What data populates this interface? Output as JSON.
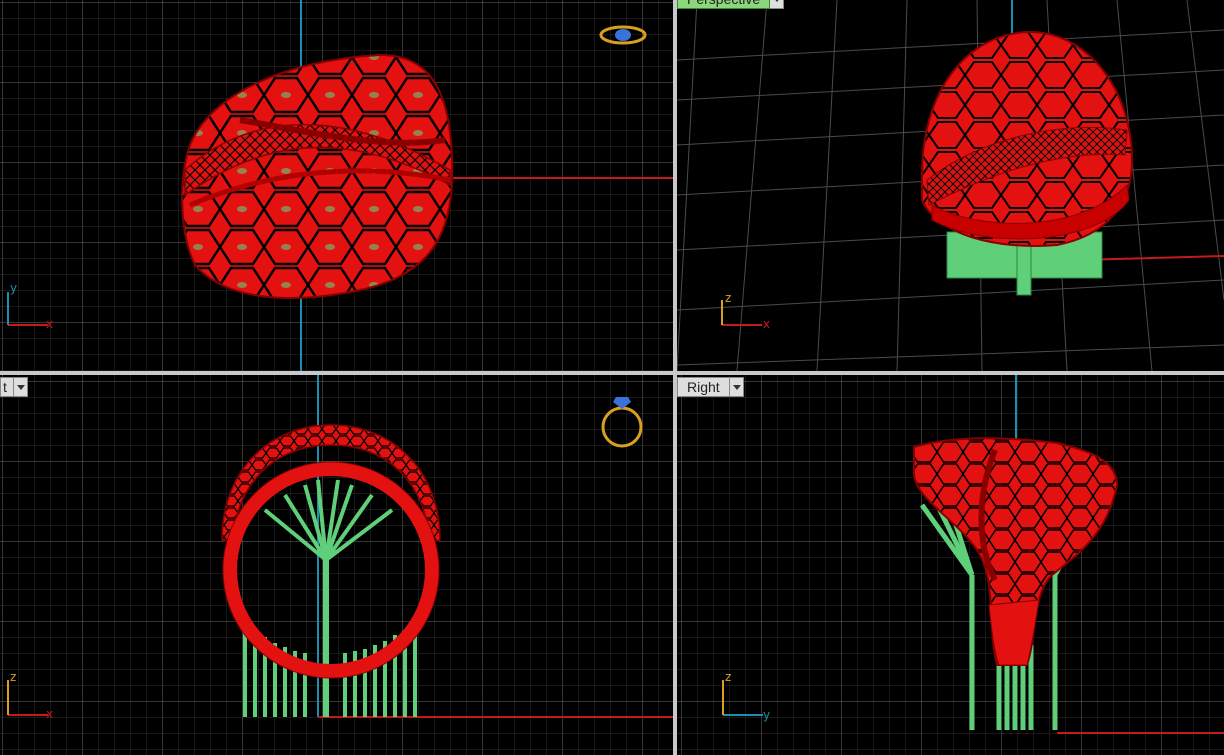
{
  "app": {
    "colors": {
      "frame": "#c8c8c8",
      "background": "#000000",
      "grid_minor": "#2e2e2e",
      "grid_major": "#6a6a6a",
      "axis_x": "#c41a1a",
      "axis_y": "#1a8fb0",
      "model": "#e41111",
      "model_shade": "#8a0000",
      "support": "#5fcf7a",
      "gizmo": "#d9a020",
      "gem": "#3b72d9"
    }
  },
  "viewports": [
    {
      "id": "top",
      "label": "",
      "axis_labels": {
        "h": "x",
        "v": "y"
      },
      "icon": "ring-top-icon"
    },
    {
      "id": "perspective",
      "label": "Perspective",
      "axis_labels": {
        "h": "x",
        "v": "z"
      }
    },
    {
      "id": "front",
      "label": "t",
      "axis_labels": {
        "h": "x",
        "v": "z"
      },
      "icon": "ring-front-icon"
    },
    {
      "id": "right",
      "label": "Right",
      "axis_labels": {
        "h": "y",
        "v": "z"
      }
    }
  ]
}
